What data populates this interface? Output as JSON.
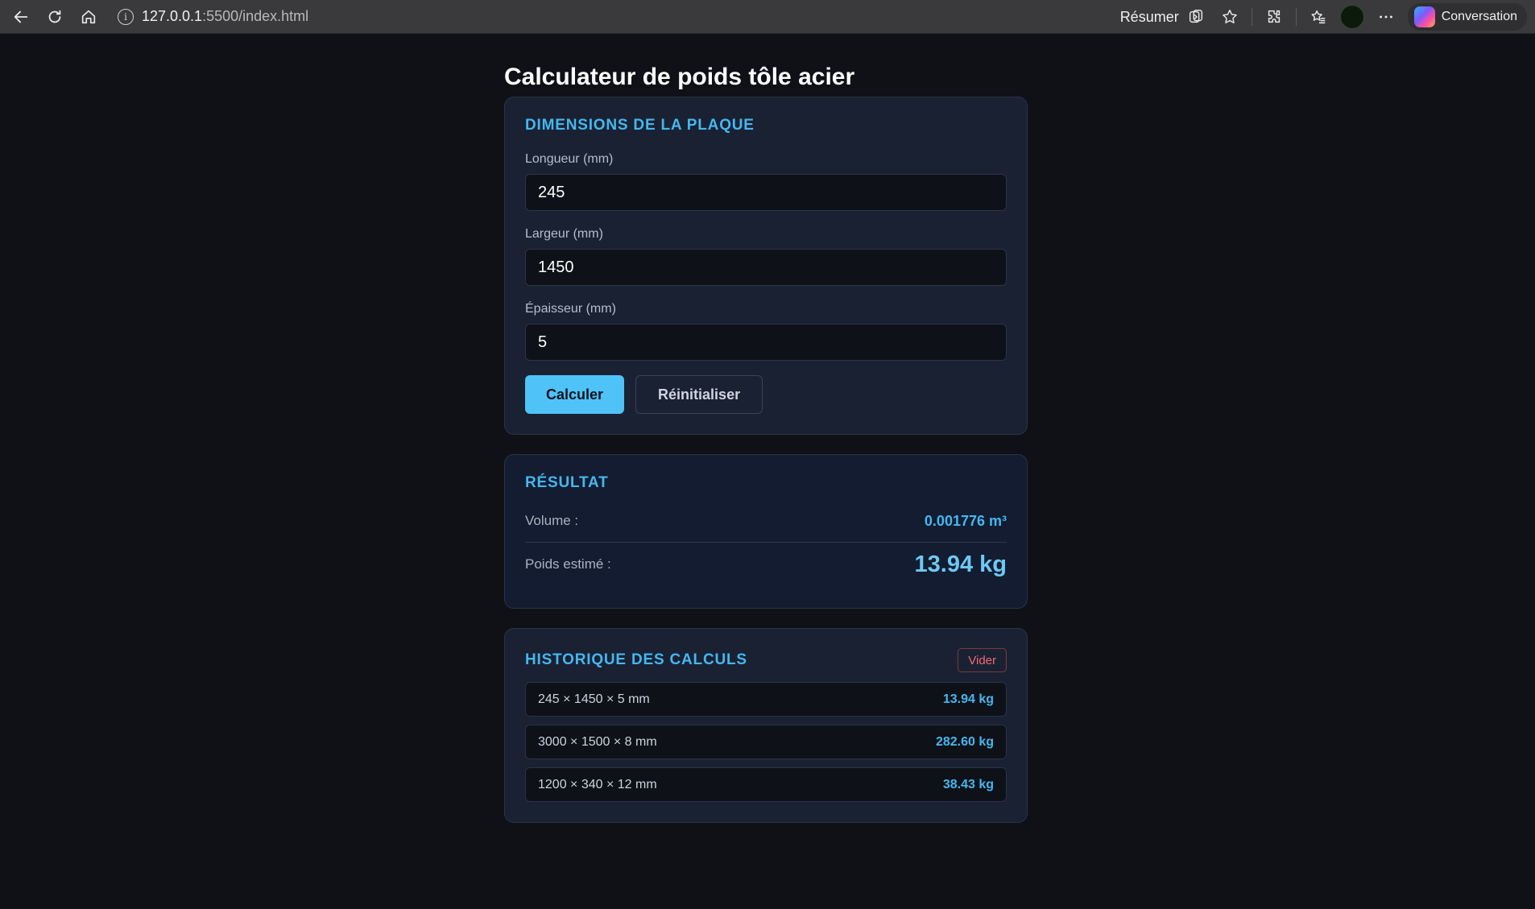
{
  "browser": {
    "url_host": "127.0.0.1",
    "url_path": ":5500/index.html",
    "resume_label": "Résumer",
    "conversation_label": "Conversation"
  },
  "app": {
    "title": "Calculateur de poids tôle acier",
    "dimensions": {
      "heading": "Dimensions de la plaque",
      "length_label": "Longueur (mm)",
      "length_value": "245",
      "width_label": "Largeur (mm)",
      "width_value": "1450",
      "thickness_label": "Épaisseur (mm)",
      "thickness_value": "5",
      "calculate_label": "Calculer",
      "reset_label": "Réinitialiser"
    },
    "result": {
      "heading": "Résultat",
      "volume_label": "Volume :",
      "volume_value": "0.001776 m³",
      "weight_label": "Poids estimé :",
      "weight_value": "13.94 kg"
    },
    "history": {
      "heading": "Historique des calculs",
      "clear_label": "Vider",
      "items": [
        {
          "dims": "245 × 1450 × 5 mm",
          "weight": "13.94 kg"
        },
        {
          "dims": "3000 × 1500 × 8 mm",
          "weight": "282.60 kg"
        },
        {
          "dims": "1200 × 340 × 12 mm",
          "weight": "38.43 kg"
        }
      ]
    }
  },
  "colors": {
    "accent": "#4fc3f7",
    "heading": "#45b7ef",
    "background": "#0f1117",
    "card": "#1a2133",
    "danger": "#ef6b74"
  }
}
